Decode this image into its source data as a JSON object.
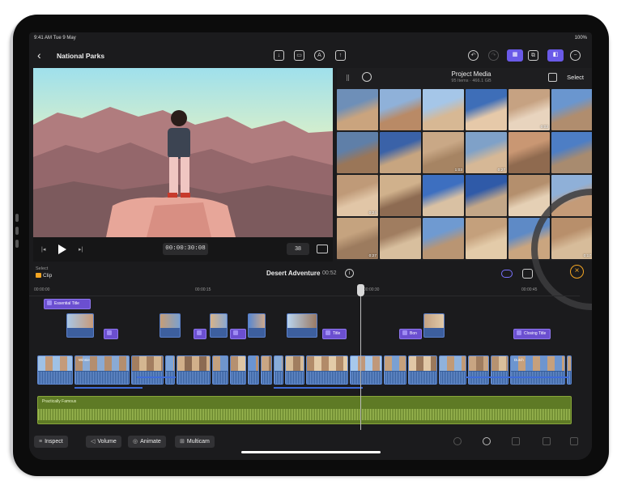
{
  "status": {
    "time": "9:41 AM  Tue 9 May",
    "battery": "100%"
  },
  "project": {
    "title": "National Parks",
    "back_icon": "chevron-left-icon"
  },
  "viewer": {
    "timecode": "00:00:30:08",
    "zoom": "38"
  },
  "browser": {
    "title": "Project Media",
    "subtitle": "95 Items · 466.1 GB",
    "select_label": "Select",
    "durations": [
      "",
      "",
      "",
      "",
      "0:02",
      "",
      "",
      "",
      "1:03",
      "0:27",
      "",
      "",
      "0:24",
      "",
      "",
      "",
      "",
      "",
      "0:27",
      "",
      "",
      "",
      "",
      "0:17"
    ]
  },
  "timeline": {
    "select_label": "Select",
    "clip_label": "Clip",
    "project_name": "Desert Adventure",
    "duration": "00:52",
    "ruler": [
      "00:00:00",
      "00:00:15",
      "00:00:30",
      "00:00:45"
    ],
    "titles": [
      "Essential Title",
      "Title",
      "Title",
      "Bon",
      "Closing Title"
    ],
    "primary_label_1": "Winnie",
    "primary_label_2": "Dutch",
    "music_label": "Practically Famous"
  },
  "bottom": {
    "inspect": "Inspect",
    "volume": "Volume",
    "animate": "Animate",
    "multicam": "Multicam"
  },
  "colors": {
    "accent": "#6a5ae8",
    "title": "#6b4fd0",
    "clip": "#355d9b",
    "music": "#5e7a25"
  }
}
